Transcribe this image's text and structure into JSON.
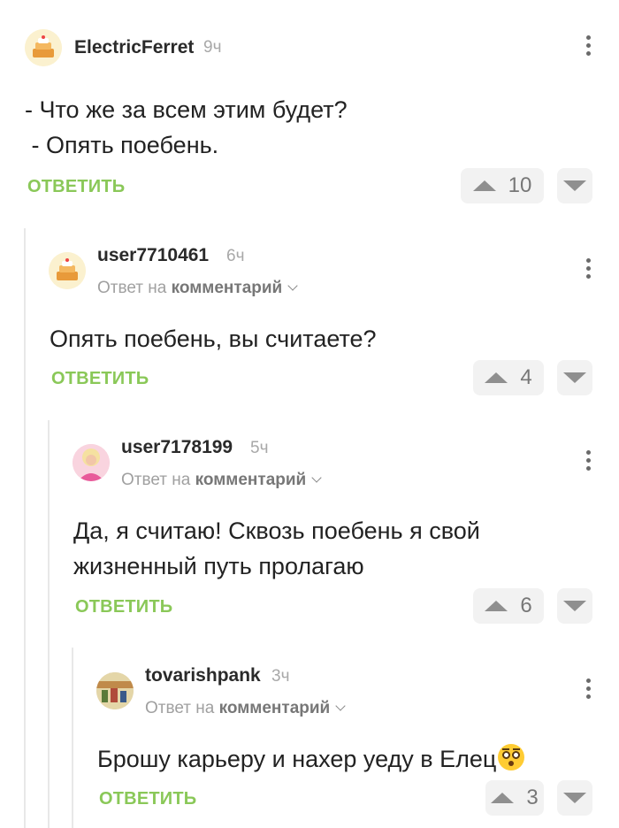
{
  "comments": [
    {
      "username": "ElectricFerret",
      "time": "9ч",
      "text_lines": [
        "- Что же за всем этим будет?",
        " - Опять поебень."
      ],
      "reply_label": "ОТВЕТИТЬ",
      "votes": "10",
      "avatar_icon": "cake-avatar-icon"
    },
    {
      "username": "user7710461",
      "time": "6ч",
      "reply_prefix": "Ответ на",
      "reply_target": "комментарий",
      "text_lines": [
        "Опять поебень, вы считаете?"
      ],
      "reply_label": "ОТВЕТИТЬ",
      "votes": "4",
      "avatar_icon": "cake-avatar-icon"
    },
    {
      "username": "user7178199",
      "time": "5ч",
      "reply_prefix": "Ответ на",
      "reply_target": "комментарий",
      "text_lines": [
        "Да, я считаю! Сквозь поебень я свой",
        "жизненный путь пролагаю"
      ],
      "reply_label": "ОТВЕТИТЬ",
      "votes": "6",
      "avatar_icon": "photo-avatar-icon"
    },
    {
      "username": "tovarishpank",
      "time": "3ч",
      "reply_prefix": "Ответ на",
      "reply_target": "комментарий",
      "text_lines": [
        "Брошу карьеру и нахер уеду в Елец"
      ],
      "reply_label": "ОТВЕТИТЬ",
      "votes": "3",
      "avatar_icon": "photo-avatar-icon"
    }
  ],
  "colors": {
    "accent_green": "#8ac858",
    "vote_bg": "#f2f2f2",
    "thread_line": "#e8e8e8"
  }
}
